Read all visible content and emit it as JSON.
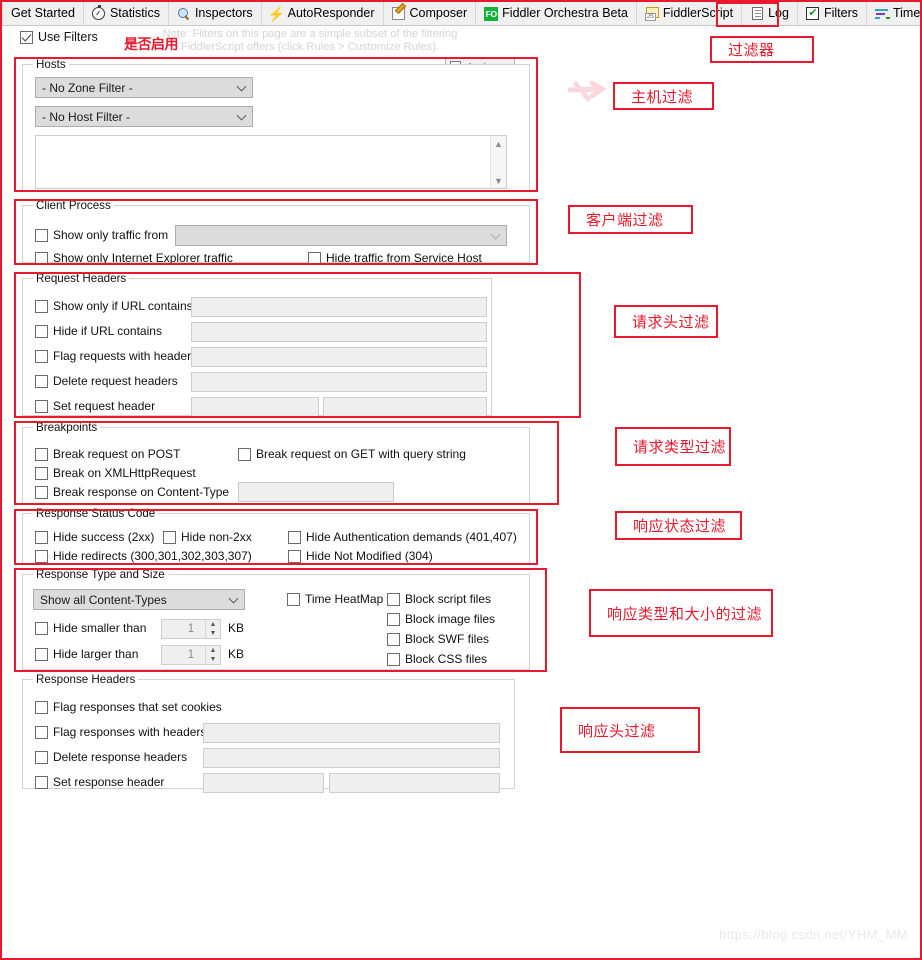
{
  "window": {
    "watermark": "https://blog.csdn.net/YHM_MM"
  },
  "tabs": [
    {
      "label": "Get Started",
      "icon": "none",
      "selected": false
    },
    {
      "label": "Statistics",
      "icon": "stopwatch-icon",
      "selected": false
    },
    {
      "label": "Inspectors",
      "icon": "magnifier-icon",
      "selected": false
    },
    {
      "label": "AutoResponder",
      "icon": "lightning-bolt-icon",
      "selected": false
    },
    {
      "label": "Composer",
      "icon": "compose-pencil-icon",
      "selected": false
    },
    {
      "label": "Fiddler Orchestra Beta",
      "icon": "fo-badge-icon",
      "selected": false
    },
    {
      "label": "FiddlerScript",
      "icon": "js-script-icon",
      "selected": false
    },
    {
      "label": "Log",
      "icon": "log-page-icon",
      "selected": false
    },
    {
      "label": "Filters",
      "icon": "filter-check-icon",
      "selected": true
    },
    {
      "label": "Timeline",
      "icon": "timeline-bars-icon",
      "selected": false
    }
  ],
  "toolbar": {
    "use_filters_label": "Use Filters",
    "use_filters_checked": true,
    "hint_text": "Note: Filters on this page are a simple subset of the filtering FiddlerScript offers (click Rules > Customize Rules).",
    "actions_label": "Actions",
    "inline_annotation": "是否启用"
  },
  "groups": {
    "hosts": {
      "title": "Hosts",
      "zone_filter_value": "- No Zone Filter -",
      "host_filter_value": "- No Host Filter -",
      "host_list_value": ""
    },
    "client_process": {
      "title": "Client Process",
      "show_only_traffic_from_label": "Show only traffic from",
      "show_only_traffic_from_checked": false,
      "process_combo_value": "",
      "show_only_ie_label": "Show only Internet Explorer traffic",
      "show_only_ie_checked": false,
      "hide_service_host_label": "Hide traffic from Service Host",
      "hide_service_host_checked": false
    },
    "request_headers": {
      "title": "Request Headers",
      "rows": [
        {
          "label": "Show only if URL contains",
          "checked": false,
          "value": ""
        },
        {
          "label": "Hide if URL contains",
          "checked": false,
          "value": ""
        },
        {
          "label": "Flag requests with headers",
          "checked": false,
          "value": ""
        },
        {
          "label": "Delete request headers",
          "checked": false,
          "value": ""
        },
        {
          "label": "Set request header",
          "checked": false,
          "value": "",
          "value2": ""
        }
      ]
    },
    "breakpoints": {
      "title": "Breakpoints",
      "break_post_label": "Break request on POST",
      "break_post_checked": false,
      "break_get_query_label": "Break request on GET with query string",
      "break_get_query_checked": false,
      "break_xhr_label": "Break on XMLHttpRequest",
      "break_xhr_checked": false,
      "break_response_ct_label": "Break response on Content-Type",
      "break_response_ct_checked": false,
      "break_response_ct_value": ""
    },
    "response_status": {
      "title": "Response Status Code",
      "items": [
        {
          "label": "Hide success (2xx)",
          "checked": false
        },
        {
          "label": "Hide non-2xx",
          "checked": false
        },
        {
          "label": "Hide Authentication demands (401,407)",
          "checked": false
        },
        {
          "label": "Hide redirects (300,301,302,303,307)",
          "checked": false
        },
        {
          "label": "Hide Not Modified (304)",
          "checked": false
        }
      ]
    },
    "response_type_size": {
      "title": "Response Type and Size",
      "content_types_value": "Show all Content-Types",
      "hide_smaller_label": "Hide smaller than",
      "hide_smaller_checked": false,
      "hide_smaller_value": "1",
      "hide_smaller_unit": "KB",
      "hide_larger_label": "Hide larger than",
      "hide_larger_checked": false,
      "hide_larger_value": "1",
      "hide_larger_unit": "KB",
      "time_heatmap_label": "Time HeatMap",
      "time_heatmap_checked": false,
      "block_items": [
        {
          "label": "Block script files",
          "checked": false
        },
        {
          "label": "Block image files",
          "checked": false
        },
        {
          "label": "Block SWF files",
          "checked": false
        },
        {
          "label": "Block CSS files",
          "checked": false
        }
      ]
    },
    "response_headers": {
      "title": "Response Headers",
      "rows": [
        {
          "label": "Flag responses that set cookies",
          "checked": false,
          "value": null
        },
        {
          "label": "Flag responses with headers",
          "checked": false,
          "value": ""
        },
        {
          "label": "Delete response headers",
          "checked": false,
          "value": ""
        },
        {
          "label": "Set response header",
          "checked": false,
          "value": "",
          "value2": ""
        }
      ]
    }
  },
  "annotations": [
    {
      "id": "filters-tab",
      "text": "过滤器"
    },
    {
      "id": "hosts",
      "text": "主机过滤"
    },
    {
      "id": "client-process",
      "text": "客户端过滤"
    },
    {
      "id": "request-headers",
      "text": "请求头过滤"
    },
    {
      "id": "breakpoints",
      "text": "请求类型过滤"
    },
    {
      "id": "response-status",
      "text": "响应状态过滤"
    },
    {
      "id": "response-type-size",
      "text": "响应类型和大小的过滤"
    },
    {
      "id": "response-headers",
      "text": "响应头过滤"
    }
  ],
  "colors": {
    "annotation_red": "#e8192c",
    "window_bg": "#ffffff",
    "tabbar_bg": "#f0f0f0"
  }
}
